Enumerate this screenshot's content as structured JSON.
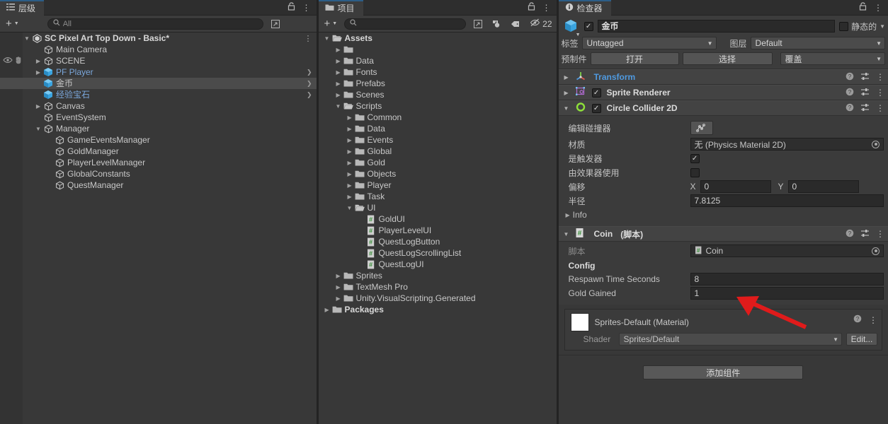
{
  "hierarchy": {
    "tab_label": "层级",
    "tab_icon": "hierarchy-icon",
    "add_label": "+",
    "search_placeholder": "All",
    "search_value": "",
    "items": [
      {
        "id": "scene-root",
        "label": "SC Pixel Art Top Down - Basic*",
        "depth": 0,
        "icon": "unity-scene-icon",
        "twisty": "down",
        "bold": true,
        "selected": false,
        "prefab": false,
        "kebab": true
      },
      {
        "id": "main-camera",
        "label": "Main Camera",
        "depth": 1,
        "icon": "gameobject-icon",
        "twisty": "none",
        "bold": false,
        "selected": false,
        "prefab": false
      },
      {
        "id": "scene",
        "label": "SCENE",
        "depth": 1,
        "icon": "gameobject-icon",
        "twisty": "right",
        "bold": false,
        "selected": false,
        "prefab": false,
        "eye": true,
        "hand": true
      },
      {
        "id": "pf-player",
        "label": "PF Player",
        "depth": 1,
        "icon": "prefab-icon",
        "twisty": "right",
        "bold": false,
        "selected": false,
        "prefab": true,
        "chevron": true
      },
      {
        "id": "jinbi",
        "label": "金币",
        "depth": 1,
        "icon": "prefab-icon",
        "twisty": "none",
        "bold": false,
        "selected": true,
        "prefab": false,
        "chevron": true
      },
      {
        "id": "jingyanbaoshi",
        "label": "经验宝石",
        "depth": 1,
        "icon": "prefab-icon",
        "twisty": "none",
        "bold": false,
        "selected": false,
        "prefab": true,
        "chevron": true
      },
      {
        "id": "canvas",
        "label": "Canvas",
        "depth": 1,
        "icon": "gameobject-icon",
        "twisty": "right",
        "bold": false,
        "selected": false,
        "prefab": false
      },
      {
        "id": "eventsystem",
        "label": "EventSystem",
        "depth": 1,
        "icon": "gameobject-icon",
        "twisty": "none",
        "bold": false,
        "selected": false,
        "prefab": false
      },
      {
        "id": "manager",
        "label": "Manager",
        "depth": 1,
        "icon": "gameobject-icon",
        "twisty": "down",
        "bold": false,
        "selected": false,
        "prefab": false
      },
      {
        "id": "gameeventsmanager",
        "label": "GameEventsManager",
        "depth": 2,
        "icon": "gameobject-icon",
        "twisty": "none",
        "bold": false,
        "selected": false,
        "prefab": false
      },
      {
        "id": "goldmanager",
        "label": "GoldManager",
        "depth": 2,
        "icon": "gameobject-icon",
        "twisty": "none",
        "bold": false,
        "selected": false,
        "prefab": false
      },
      {
        "id": "playerlevelmanager",
        "label": "PlayerLevelManager",
        "depth": 2,
        "icon": "gameobject-icon",
        "twisty": "none",
        "bold": false,
        "selected": false,
        "prefab": false
      },
      {
        "id": "globalconstants",
        "label": "GlobalConstants",
        "depth": 2,
        "icon": "gameobject-icon",
        "twisty": "none",
        "bold": false,
        "selected": false,
        "prefab": false
      },
      {
        "id": "questmanager",
        "label": "QuestManager",
        "depth": 2,
        "icon": "gameobject-icon",
        "twisty": "none",
        "bold": false,
        "selected": false,
        "prefab": false
      }
    ]
  },
  "project": {
    "tab_label": "项目",
    "tab_icon": "folder-icon",
    "add_label": "+",
    "search_placeholder": "",
    "search_value": "",
    "hidden_count": "22",
    "items": [
      {
        "id": "assets",
        "label": "Assets",
        "depth": 0,
        "icon": "folder-open-icon",
        "twisty": "down",
        "bold": true
      },
      {
        "id": "unnamed",
        "label": "",
        "depth": 1,
        "icon": "folder-icon",
        "twisty": "right",
        "bold": false
      },
      {
        "id": "data",
        "label": "Data",
        "depth": 1,
        "icon": "folder-icon",
        "twisty": "right",
        "bold": false
      },
      {
        "id": "fonts",
        "label": "Fonts",
        "depth": 1,
        "icon": "folder-icon",
        "twisty": "right",
        "bold": false
      },
      {
        "id": "prefabs",
        "label": "Prefabs",
        "depth": 1,
        "icon": "folder-icon",
        "twisty": "right",
        "bold": false
      },
      {
        "id": "scenes",
        "label": "Scenes",
        "depth": 1,
        "icon": "folder-icon",
        "twisty": "right",
        "bold": false
      },
      {
        "id": "scripts",
        "label": "Scripts",
        "depth": 1,
        "icon": "folder-open-icon",
        "twisty": "down",
        "bold": false
      },
      {
        "id": "common",
        "label": "Common",
        "depth": 2,
        "icon": "folder-icon",
        "twisty": "right",
        "bold": false
      },
      {
        "id": "sdata",
        "label": "Data",
        "depth": 2,
        "icon": "folder-icon",
        "twisty": "right",
        "bold": false
      },
      {
        "id": "events",
        "label": "Events",
        "depth": 2,
        "icon": "folder-icon",
        "twisty": "right",
        "bold": false
      },
      {
        "id": "global",
        "label": "Global",
        "depth": 2,
        "icon": "folder-icon",
        "twisty": "right",
        "bold": false
      },
      {
        "id": "gold",
        "label": "Gold",
        "depth": 2,
        "icon": "folder-icon",
        "twisty": "right",
        "bold": false
      },
      {
        "id": "objects",
        "label": "Objects",
        "depth": 2,
        "icon": "folder-icon",
        "twisty": "right",
        "bold": false
      },
      {
        "id": "player",
        "label": "Player",
        "depth": 2,
        "icon": "folder-icon",
        "twisty": "right",
        "bold": false
      },
      {
        "id": "task",
        "label": "Task",
        "depth": 2,
        "icon": "folder-icon",
        "twisty": "right",
        "bold": false
      },
      {
        "id": "ui",
        "label": "UI",
        "depth": 2,
        "icon": "folder-open-icon",
        "twisty": "down",
        "bold": false
      },
      {
        "id": "goldui",
        "label": "GoldUI",
        "depth": 3,
        "icon": "csharp-script-icon",
        "twisty": "none",
        "bold": false
      },
      {
        "id": "playerlevelui",
        "label": "PlayerLevelUI",
        "depth": 3,
        "icon": "csharp-script-icon",
        "twisty": "none",
        "bold": false
      },
      {
        "id": "questlogbutton",
        "label": "QuestLogButton",
        "depth": 3,
        "icon": "csharp-script-icon",
        "twisty": "none",
        "bold": false
      },
      {
        "id": "questlogscrollinglist",
        "label": "QuestLogScrollingList",
        "depth": 3,
        "icon": "csharp-script-icon",
        "twisty": "none",
        "bold": false
      },
      {
        "id": "questlogui",
        "label": "QuestLogUI",
        "depth": 3,
        "icon": "csharp-script-icon",
        "twisty": "none",
        "bold": false
      },
      {
        "id": "sprites",
        "label": "Sprites",
        "depth": 1,
        "icon": "folder-icon",
        "twisty": "right",
        "bold": false
      },
      {
        "id": "textmeshpro",
        "label": "TextMesh Pro",
        "depth": 1,
        "icon": "folder-icon",
        "twisty": "right",
        "bold": false
      },
      {
        "id": "unityvisualscripting",
        "label": "Unity.VisualScripting.Generated",
        "depth": 1,
        "icon": "folder-icon",
        "twisty": "right",
        "bold": false
      },
      {
        "id": "packages",
        "label": "Packages",
        "depth": 0,
        "icon": "folder-icon",
        "twisty": "right",
        "bold": true
      }
    ]
  },
  "inspector": {
    "tab_label": "检查器",
    "tab_icon": "info-icon",
    "object_name": "金币",
    "object_enabled": true,
    "static_label": "静态的",
    "static_checked": false,
    "tag_label": "标签",
    "tag_value": "Untagged",
    "layer_label": "图层",
    "layer_value": "Default",
    "prefab_label": "预制件",
    "prefab_open": "打开",
    "prefab_select": "选择",
    "prefab_overrides": "覆盖",
    "components": [
      {
        "id": "transform",
        "title": "Transform",
        "icon": "transform-icon",
        "expanded": false,
        "has_checkbox": false,
        "title_color": "blue"
      },
      {
        "id": "sprite-renderer",
        "title": "Sprite Renderer",
        "icon": "sprite-renderer-icon",
        "expanded": false,
        "has_checkbox": true,
        "checked": true,
        "title_color": "white"
      },
      {
        "id": "circle-collider-2d",
        "title": "Circle Collider 2D",
        "icon": "circle-collider-icon",
        "expanded": true,
        "has_checkbox": true,
        "checked": true,
        "title_color": "white"
      }
    ],
    "collider": {
      "edit_label": "编辑碰撞器",
      "material_label": "材质",
      "material_value": "无 (Physics Material 2D)",
      "is_trigger_label": "是触发器",
      "is_trigger_checked": true,
      "used_by_effector_label": "由效果器使用",
      "used_by_effector_checked": false,
      "offset_label": "偏移",
      "offset_x_axis": "X",
      "offset_x": "0",
      "offset_y_axis": "Y",
      "offset_y": "0",
      "radius_label": "半径",
      "radius_value": "7.8125",
      "info_label": "Info"
    },
    "coin_component": {
      "title": "Coin",
      "title_suffix": "(脚本)",
      "icon": "csharp-script-icon",
      "script_label": "脚本",
      "script_value": "Coin",
      "config_header": "Config",
      "respawn_label": "Respawn Time Seconds",
      "respawn_value": "8",
      "gold_label": "Gold Gained",
      "gold_value": "1"
    },
    "material_block": {
      "title": "Sprites-Default (Material)",
      "shader_label": "Shader",
      "shader_value": "Sprites/Default",
      "edit_label": "Edit..."
    },
    "add_component_label": "添加组件"
  },
  "annotation": {
    "arrow_color": "#e01b1b",
    "arrow_name": "red-pointer-arrow"
  }
}
